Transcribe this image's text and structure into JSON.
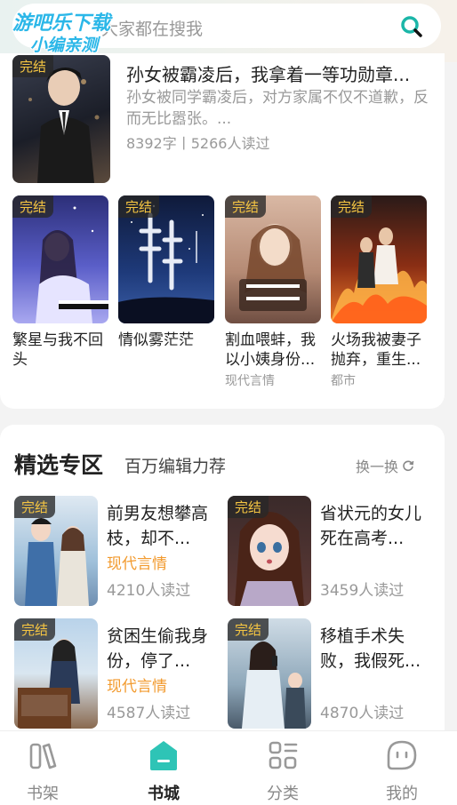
{
  "search": {
    "placeholder": "大家都在搜我"
  },
  "watermark": {
    "line1": "游吧乐下载",
    "line2": "小编亲测"
  },
  "recommend": {
    "featured": {
      "badge": "完结",
      "title": "孙女被霸凌后，我拿着一等功勋章...",
      "desc": "孙女被同学霸凌后，对方家属不仅不道歉，反而无比嚣张。...",
      "meta": "8392字丨5266人读过"
    },
    "grid": [
      {
        "badge": "完结",
        "title": "繁星与我不回头",
        "category": ""
      },
      {
        "badge": "完结",
        "title": "情似雾茫茫",
        "category": ""
      },
      {
        "badge": "完结",
        "title": "割血喂蚌，我以小姨身份...",
        "category": "现代言情"
      },
      {
        "badge": "完结",
        "title": "火场我被妻子抛弃，重生...",
        "category": "都市"
      }
    ]
  },
  "zone": {
    "title": "精选专区",
    "subtitle": "百万编辑力荐",
    "refresh": "换一换",
    "books": [
      {
        "badge": "完结",
        "title": "前男友想攀高枝，却不...",
        "category": "现代言情",
        "reads": "4210人读过"
      },
      {
        "badge": "完结",
        "title": "省状元的女儿死在高考...",
        "category": "",
        "reads": "3459人读过"
      },
      {
        "badge": "完结",
        "title": "贫困生偷我身份，停了...",
        "category": "现代言情",
        "reads": "4587人读过"
      },
      {
        "badge": "完结",
        "title": "移植手术失败，我假死...",
        "category": "",
        "reads": "4870人读过"
      }
    ]
  },
  "nav": {
    "items": [
      {
        "label": "书架",
        "icon": "bookshelf-icon"
      },
      {
        "label": "书城",
        "icon": "bookstore-icon",
        "active": true
      },
      {
        "label": "分类",
        "icon": "category-icon"
      },
      {
        "label": "我的",
        "icon": "profile-icon"
      }
    ]
  },
  "colors": {
    "accent": "#2ec4b6",
    "badge": "#f5c542",
    "category": "#f29a2e"
  }
}
